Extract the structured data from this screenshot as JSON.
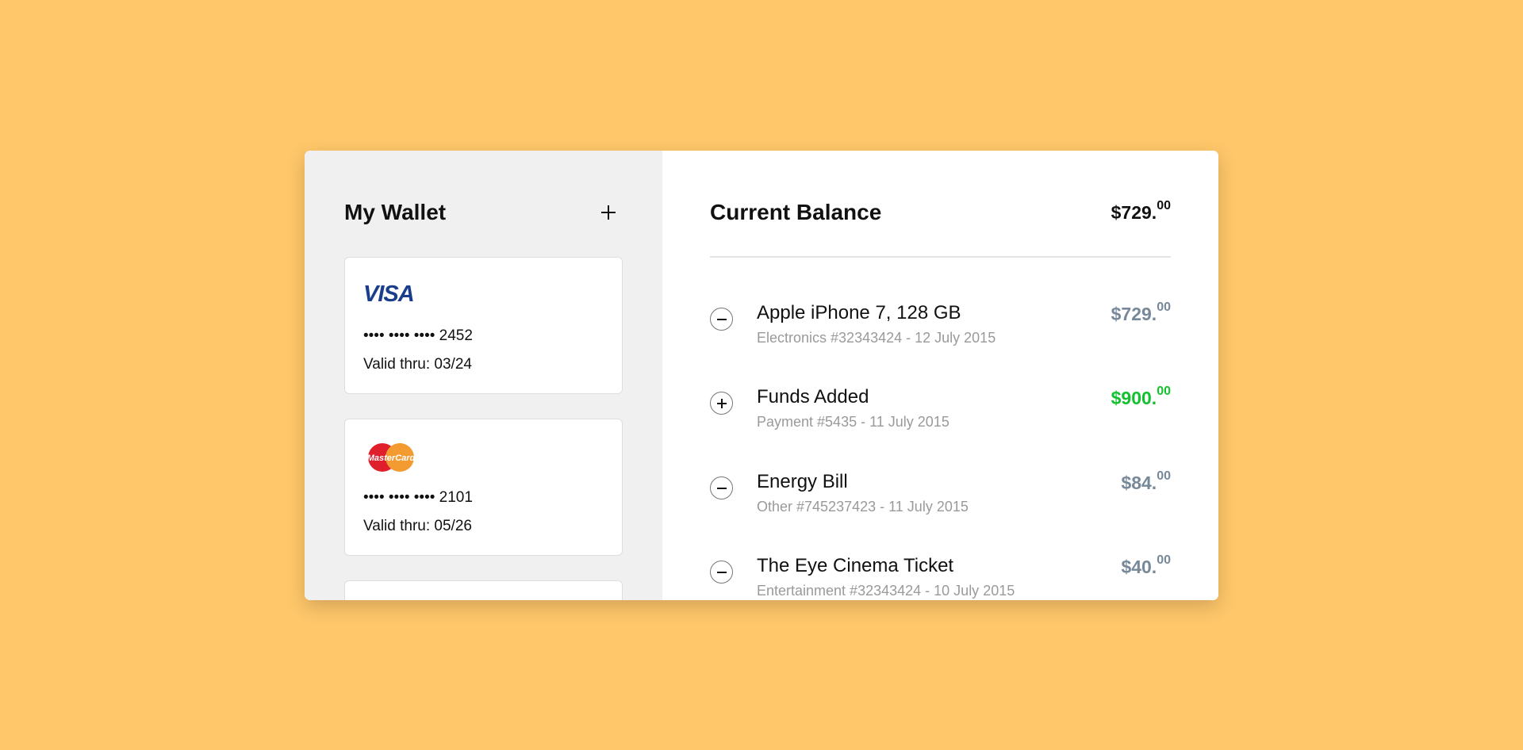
{
  "wallet": {
    "title": "My Wallet",
    "add_label": "+",
    "cards": [
      {
        "brand": "VISA",
        "logo_icon": "visa-logo-icon",
        "number": "•••• •••• •••• 2452",
        "valid": "Valid thru: 03/24"
      },
      {
        "brand": "MasterCard",
        "logo_icon": "mastercard-logo-icon",
        "number": "•••• •••• •••• 2101",
        "valid": "Valid thru: 05/26"
      }
    ]
  },
  "balance": {
    "title": "Current Balance",
    "amount_main": "$729.",
    "amount_cents": "00"
  },
  "transactions": [
    {
      "type": "debit",
      "icon": "minus-icon",
      "name": "Apple iPhone 7, 128 GB",
      "meta": "Electronics #32343424 - 12 July 2015",
      "amount_main": "$729.",
      "amount_cents": "00",
      "color": "#778899"
    },
    {
      "type": "credit",
      "icon": "plus-icon",
      "name": "Funds Added",
      "meta": "Payment #5435 - 11 July 2015",
      "amount_main": "$900.",
      "amount_cents": "00",
      "color": "#12c12e"
    },
    {
      "type": "debit",
      "icon": "minus-icon",
      "name": "Energy Bill",
      "meta": "Other #745237423 - 11 July 2015",
      "amount_main": "$84.",
      "amount_cents": "00",
      "color": "#778899"
    },
    {
      "type": "debit",
      "icon": "minus-icon",
      "name": "The Eye Cinema Ticket",
      "meta": "Entertainment #32343424 - 10 July 2015",
      "amount_main": "$40.",
      "amount_cents": "00",
      "color": "#778899"
    }
  ],
  "colors": {
    "background": "#FFC76A",
    "positive": "#12c12e",
    "neutral_amount": "#778899"
  }
}
